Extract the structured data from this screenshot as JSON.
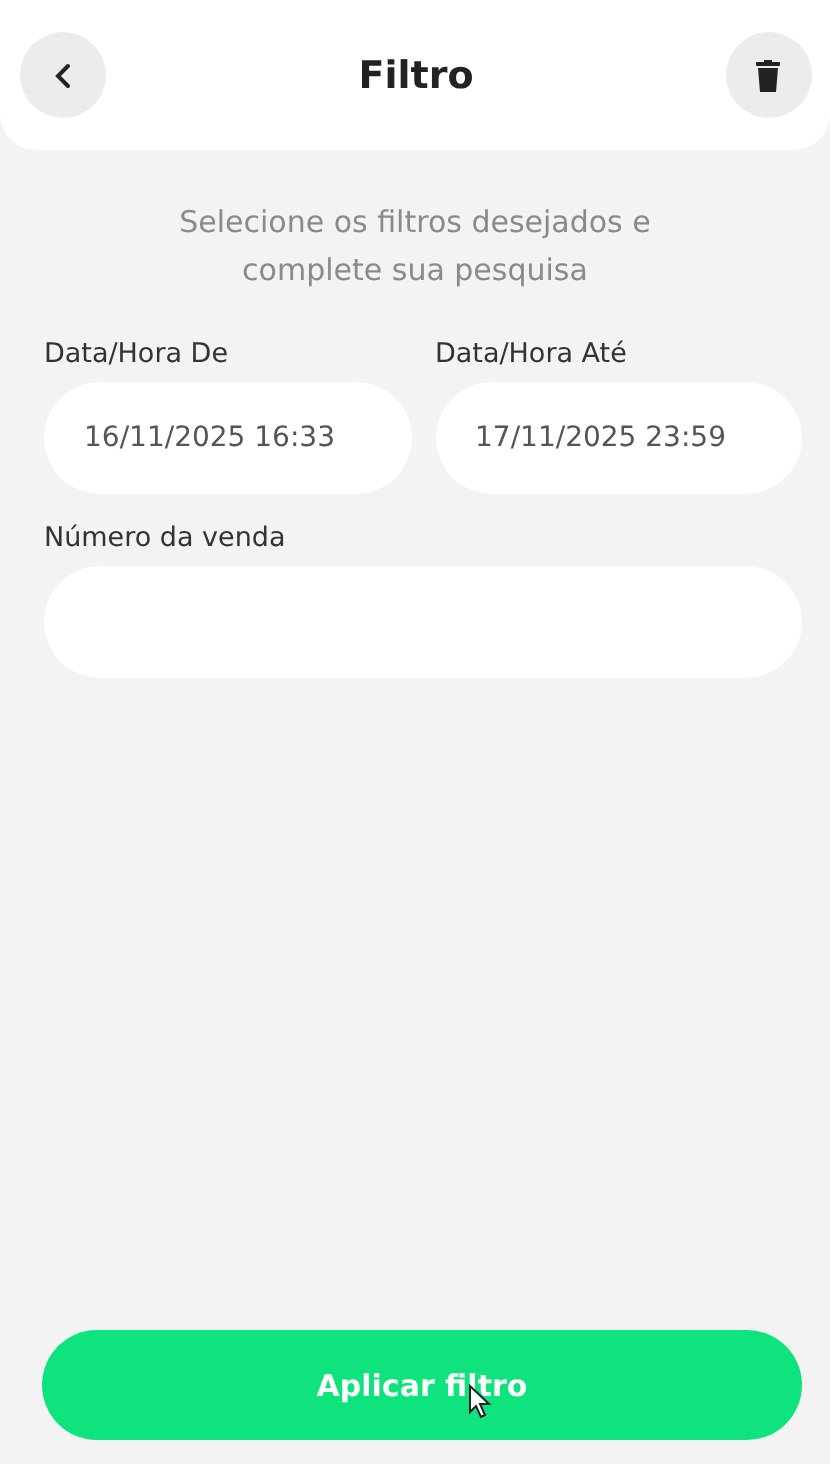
{
  "header": {
    "title": "Filtro"
  },
  "instructions": "Selecione os filtros desejados e complete sua pesquisa",
  "date_fields": [
    {
      "label": "Data/Hora De",
      "value": "16/11/2025 16:33"
    },
    {
      "label": "Data/Hora Até",
      "value": "17/11/2025 23:59"
    }
  ],
  "sale_number_field": {
    "label": "Número da venda"
  },
  "apply_button": {
    "label": "Aplicar filtro"
  }
}
